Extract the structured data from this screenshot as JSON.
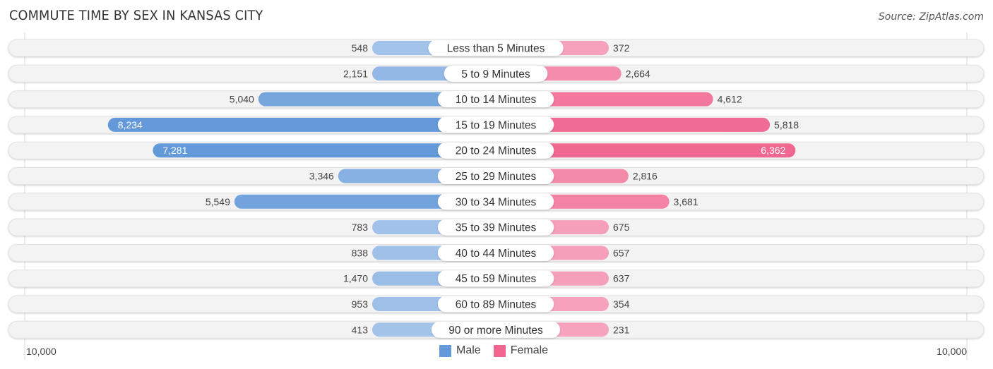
{
  "header": {
    "title": "COMMUTE TIME BY SEX IN KANSAS CITY",
    "source": "Source: ZipAtlas.com"
  },
  "colors": {
    "male": "#6399d8",
    "male_light": "#a7c6ea",
    "female": "#f0648e",
    "female_light": "#f6a6bf",
    "track": "#f3f3f3"
  },
  "chart_data": {
    "type": "bar",
    "orientation": "horizontal-diverging",
    "title": "COMMUTE TIME BY SEX IN KANSAS CITY",
    "categories": [
      "Less than 5 Minutes",
      "5 to 9 Minutes",
      "10 to 14 Minutes",
      "15 to 19 Minutes",
      "20 to 24 Minutes",
      "25 to 29 Minutes",
      "30 to 34 Minutes",
      "35 to 39 Minutes",
      "40 to 44 Minutes",
      "45 to 59 Minutes",
      "60 to 89 Minutes",
      "90 or more Minutes"
    ],
    "series": [
      {
        "name": "Male",
        "values": [
          548,
          2151,
          5040,
          8234,
          7281,
          3346,
          5549,
          783,
          838,
          1470,
          953,
          413
        ],
        "labels": [
          "548",
          "2,151",
          "5,040",
          "8,234",
          "7,281",
          "3,346",
          "5,549",
          "783",
          "838",
          "1,470",
          "953",
          "413"
        ]
      },
      {
        "name": "Female",
        "values": [
          372,
          2664,
          4612,
          5818,
          6362,
          2816,
          3681,
          675,
          657,
          637,
          354,
          231
        ],
        "labels": [
          "372",
          "2,664",
          "4,612",
          "5,818",
          "6,362",
          "2,816",
          "3,681",
          "675",
          "657",
          "637",
          "354",
          "231"
        ]
      }
    ],
    "xlim": [
      -10000,
      10000
    ],
    "axis_labels": {
      "left": "10,000",
      "right": "10,000"
    },
    "legend": {
      "position": "bottom-center",
      "entries": [
        "Male",
        "Female"
      ]
    }
  }
}
